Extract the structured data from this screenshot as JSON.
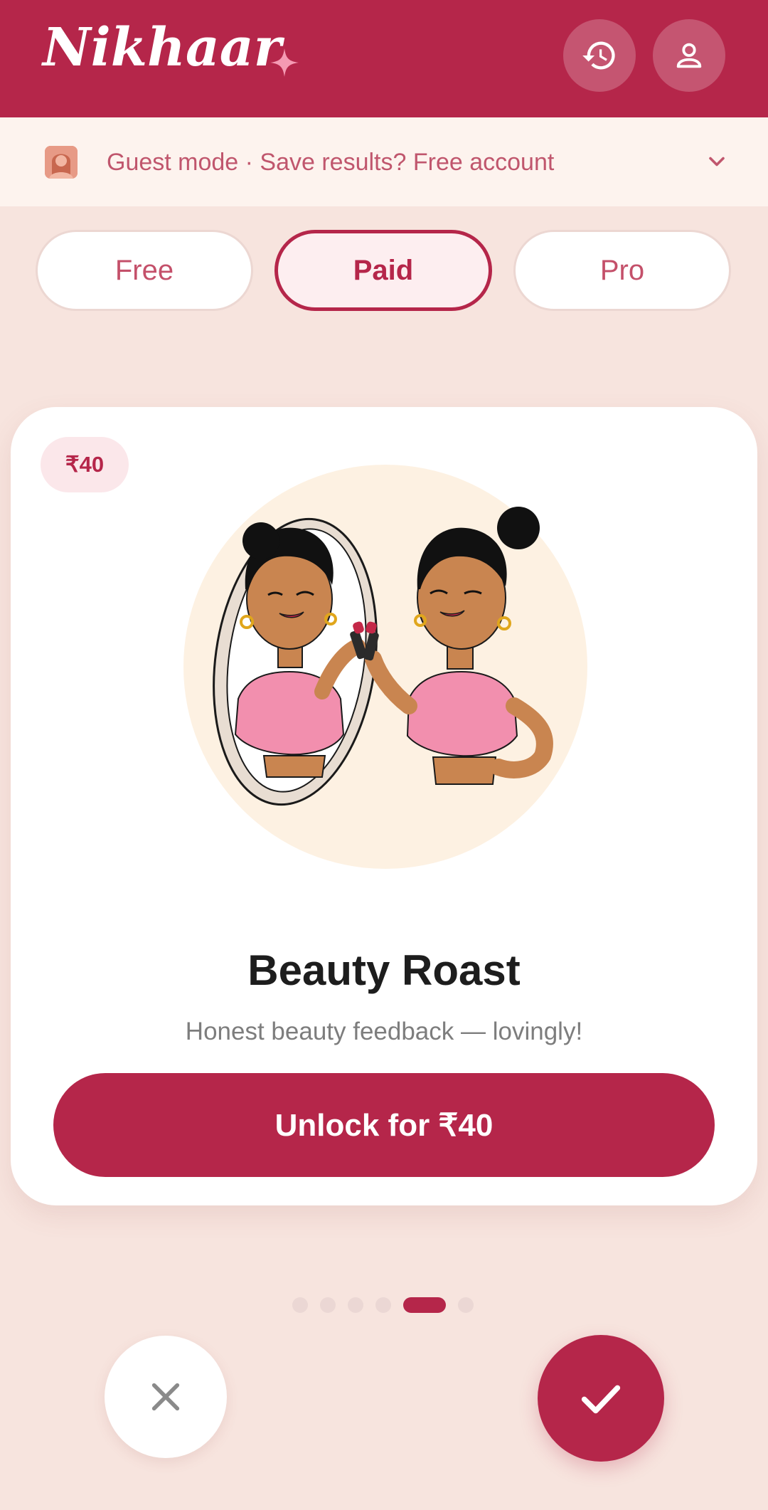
{
  "app": {
    "title": "Nikhaar"
  },
  "header": {
    "logo_text": "Nikhaar",
    "history_icon": "history-icon",
    "profile_icon": "person-icon"
  },
  "guest_bar": {
    "text": "Guest mode · Save results? Free account",
    "avatar_icon": "woman-avatar-icon",
    "chevron_icon": "chevron-down-icon"
  },
  "tiers": [
    {
      "label": "Free",
      "selected": false
    },
    {
      "label": "Paid",
      "selected": true
    },
    {
      "label": "Pro",
      "selected": false
    }
  ],
  "card": {
    "price_badge": "₹40",
    "title": "Beauty Roast",
    "subtitle": "Honest beauty feedback — lovingly!",
    "unlock_label": "Unlock for ₹40"
  },
  "pager": {
    "count": 6,
    "active_index": 4
  },
  "actions": {
    "reject_icon": "close-icon",
    "accept_icon": "check-icon"
  },
  "colors": {
    "brand": "#b5264a",
    "background": "#f7e4de",
    "guest_bar": "#fdf3ee",
    "badge_bg": "#fbe7ea",
    "illustration_circle": "#fdf1e2",
    "top_pink": "#f28fae"
  }
}
